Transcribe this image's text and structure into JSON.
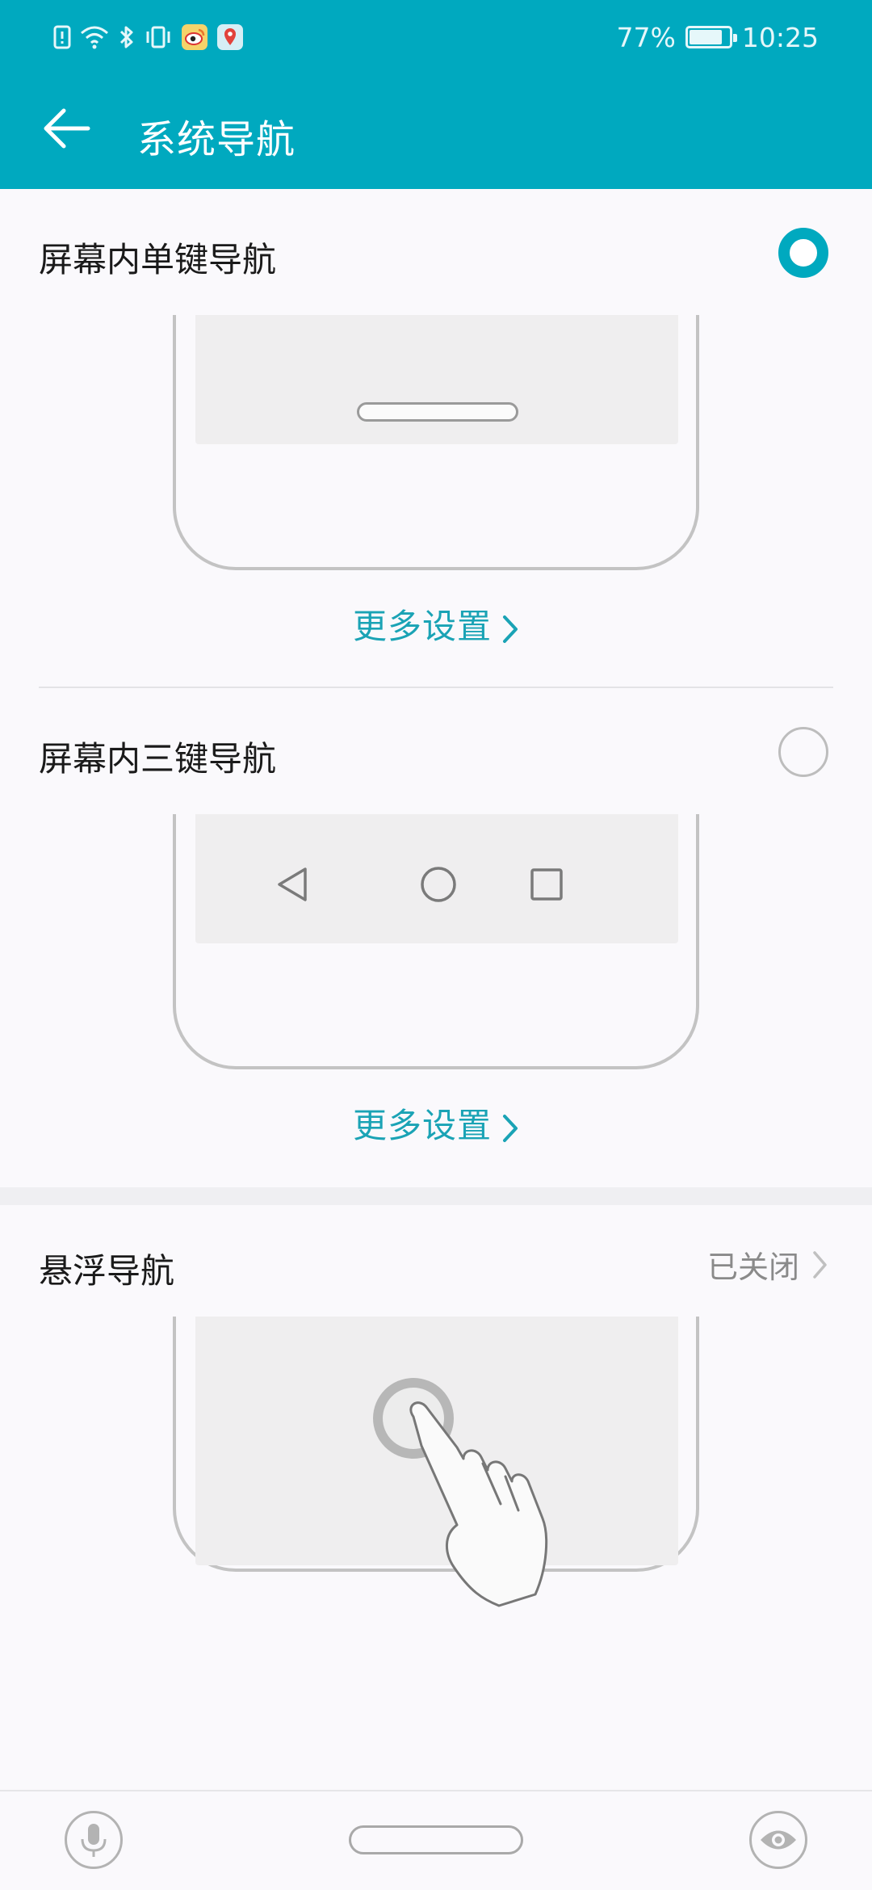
{
  "status_bar": {
    "battery": "77%",
    "time": "10:25"
  },
  "header": {
    "title": "系统导航"
  },
  "options": [
    {
      "title": "屏幕内单键导航",
      "selected": true,
      "more": "更多设置"
    },
    {
      "title": "屏幕内三键导航",
      "selected": false,
      "more": "更多设置"
    },
    {
      "title": "悬浮导航",
      "status": "已关闭"
    }
  ],
  "colors": {
    "accent": "#00a9bf",
    "link": "#1aa3b5"
  },
  "icons": [
    "back-arrow-icon",
    "chevron-right-icon",
    "mic-icon",
    "eye-icon"
  ]
}
